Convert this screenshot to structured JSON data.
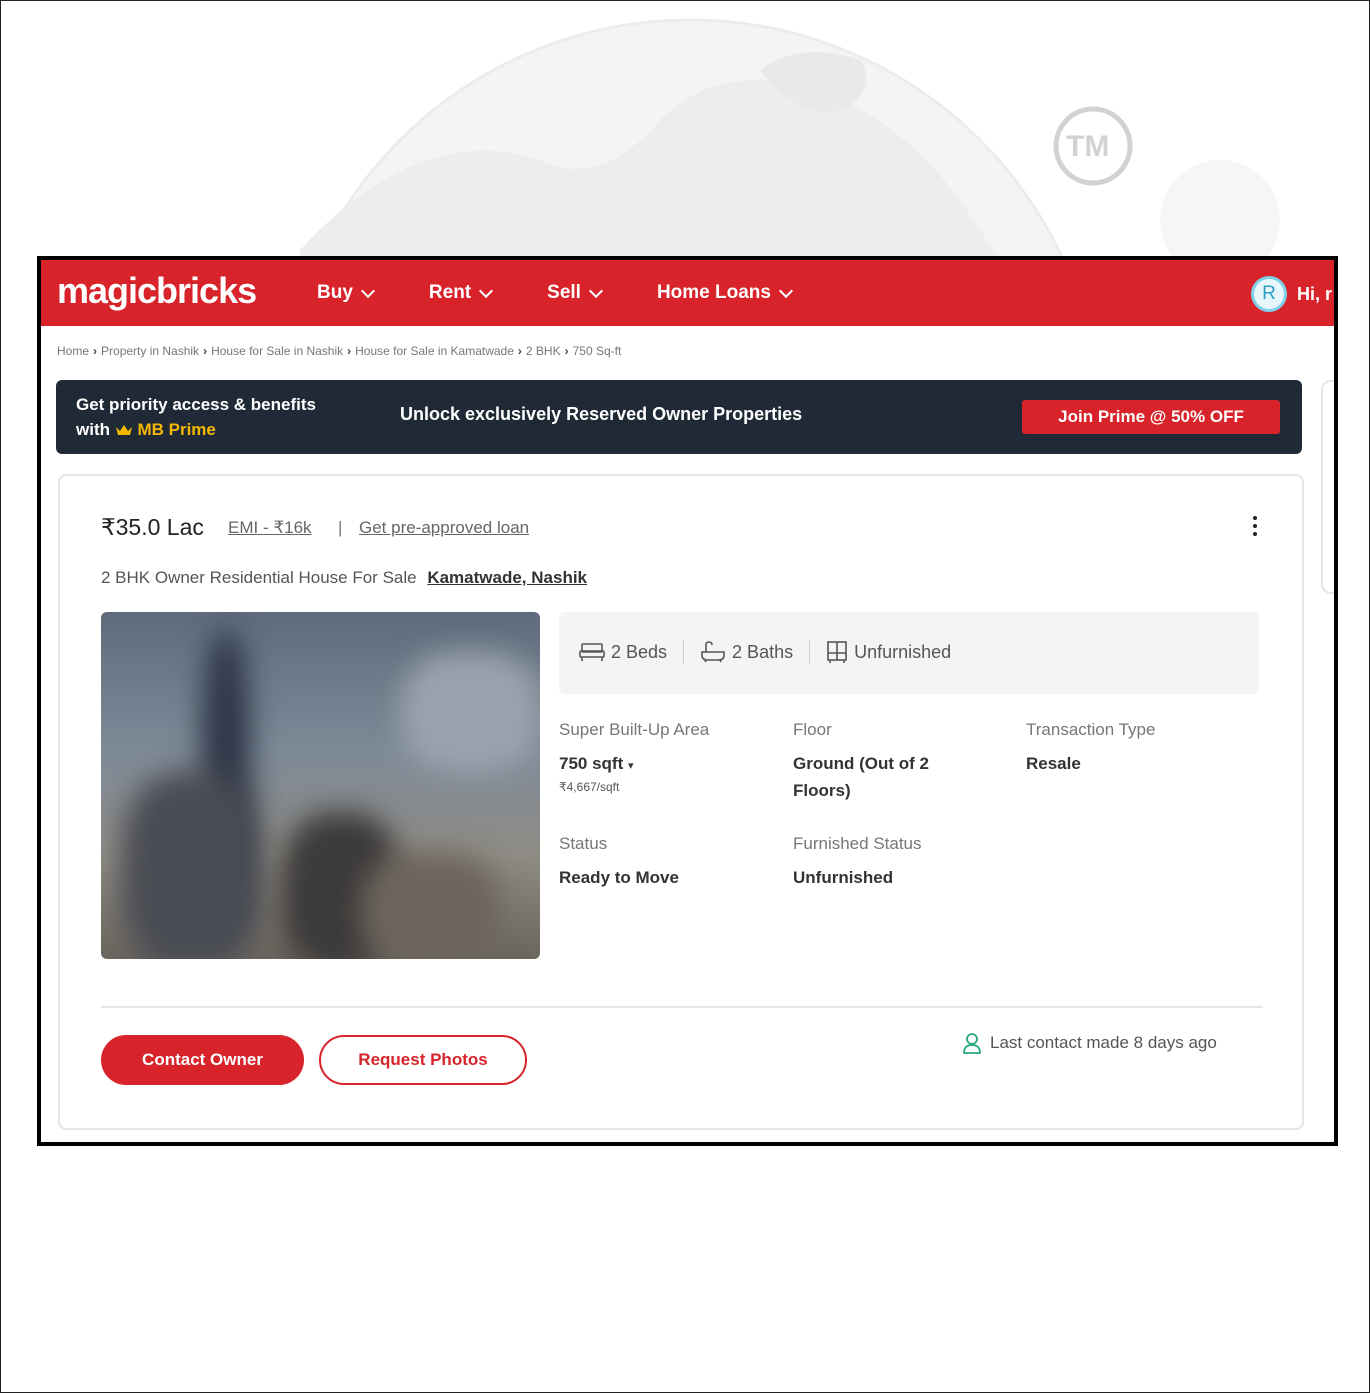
{
  "watermark": {
    "tm_label": "TM"
  },
  "nav": {
    "logo": "magicbricks",
    "menu": [
      {
        "label": "Buy"
      },
      {
        "label": "Rent"
      },
      {
        "label": "Sell"
      },
      {
        "label": "Home Loans"
      }
    ],
    "avatar_initial": "R",
    "greeting": "Hi, r"
  },
  "breadcrumb": [
    "Home",
    "Property in Nashik",
    "House for Sale in Nashik",
    "House for Sale in Kamatwade",
    "2 BHK",
    "750 Sq-ft"
  ],
  "prime": {
    "title_line1": "Get priority access & benefits",
    "title_with": "with",
    "brand": "MB Prime",
    "unlock_text": "Unlock exclusively Reserved Owner Properties",
    "join_button": "Join Prime @ 50% OFF"
  },
  "listing": {
    "price": "₹35.0 Lac",
    "emi_link": "EMI - ₹16k",
    "separator": "|",
    "loan_link": "Get pre-approved loan",
    "subtitle": "2 BHK Owner Residential House For Sale",
    "locality": "Kamatwade, Nashik",
    "amenities": {
      "beds": "2 Beds",
      "baths": "2 Baths",
      "furnishing": "Unfurnished"
    },
    "specs": {
      "area_label": "Super Built-Up Area",
      "area_value": "750 sqft",
      "area_arrow": "▾",
      "area_rate": "₹4,667/sqft",
      "floor_label": "Floor",
      "floor_value": "Ground (Out of 2 Floors)",
      "transaction_label": "Transaction Type",
      "transaction_value": "Resale",
      "status_label": "Status",
      "status_value": "Ready to Move",
      "furnished_label": "Furnished Status",
      "furnished_value": "Unfurnished"
    },
    "actions": {
      "contact_owner": "Contact Owner",
      "request_photos": "Request Photos",
      "last_contact": "Last contact made 8 days ago"
    }
  },
  "colors": {
    "brand_red": "#d8232a",
    "banner_dark": "#1f2a36",
    "prime_gold": "#f5b800"
  }
}
